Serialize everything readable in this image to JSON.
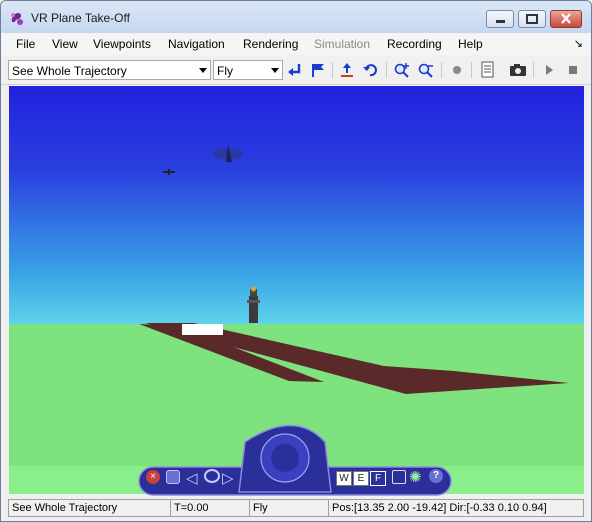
{
  "window": {
    "title": "VR Plane Take-Off"
  },
  "menu": {
    "items": [
      {
        "label": "File",
        "enabled": true
      },
      {
        "label": "View",
        "enabled": true
      },
      {
        "label": "Viewpoints",
        "enabled": true
      },
      {
        "label": "Navigation",
        "enabled": true
      },
      {
        "label": "Rendering",
        "enabled": true
      },
      {
        "label": "Simulation",
        "enabled": false
      },
      {
        "label": "Recording",
        "enabled": true
      },
      {
        "label": "Help",
        "enabled": true
      }
    ]
  },
  "toolbar": {
    "viewpoint_select": "See Whole Trajectory",
    "navmode_select": "Fly"
  },
  "navpanel": {
    "w_label": "W",
    "e_label": "E",
    "f_label": "F",
    "help_label": "?"
  },
  "status": {
    "viewpoint": "See Whole Trajectory",
    "time": "T=0.00",
    "mode": "Fly",
    "position": "Pos:[13.35 2.00 -19.42] Dir:[-0.33 0.10 0.94]"
  },
  "colors": {
    "sky_top": "#2222dd",
    "sky_horizon": "#62d2e8",
    "ground": "#7ee27e",
    "runway": "#5a2a2a"
  }
}
